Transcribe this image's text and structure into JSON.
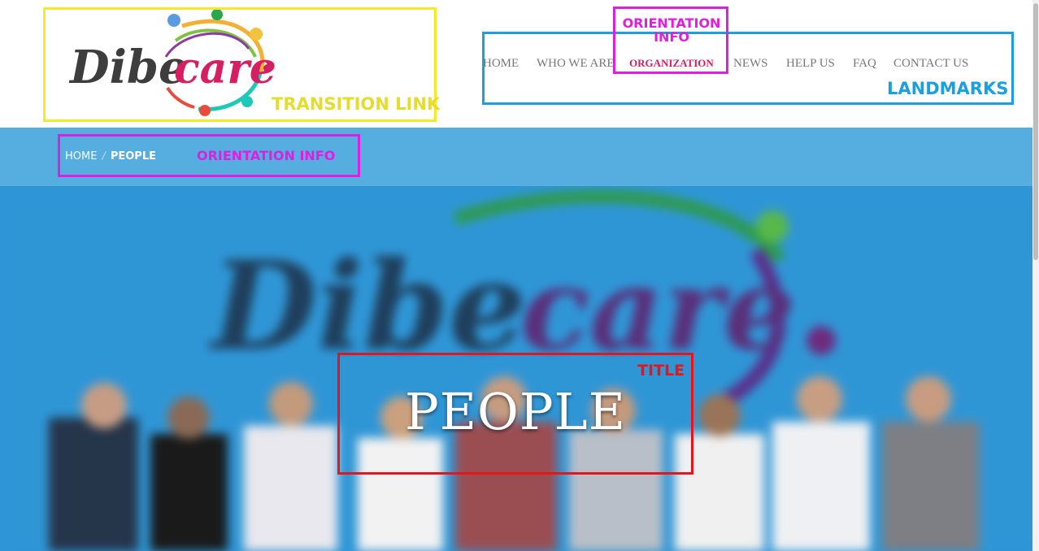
{
  "brand": {
    "name_dark": "Dibe",
    "name_accent": "care"
  },
  "nav": {
    "items": [
      {
        "label": "HOME",
        "active": false
      },
      {
        "label": "WHO WE ARE",
        "active": false
      },
      {
        "label": "ORGANIZATION",
        "active": true
      },
      {
        "label": "NEWS",
        "active": false
      },
      {
        "label": "HELP US",
        "active": false
      },
      {
        "label": "FAQ",
        "active": false
      },
      {
        "label": "CONTACT US",
        "active": false
      }
    ]
  },
  "breadcrumb": {
    "home": "HOME",
    "separator": "/",
    "current": "PEOPLE"
  },
  "hero": {
    "title": "PEOPLE"
  },
  "annotations": {
    "transition_link": "TRANSITION LINK",
    "orientation_info_nav": "ORIENTATION INFO",
    "landmarks": "LANDMARKS",
    "orientation_info_breadcrumb": "ORIENTATION INFO",
    "title": "TITLE"
  },
  "colors": {
    "accent": "#d61f63",
    "breadcrumb_bar": "#56addf",
    "annotation_yellow": "#f5e92a",
    "annotation_magenta": "#e01ee0",
    "annotation_blue": "#1a9fe0",
    "annotation_red": "#e8141a"
  }
}
